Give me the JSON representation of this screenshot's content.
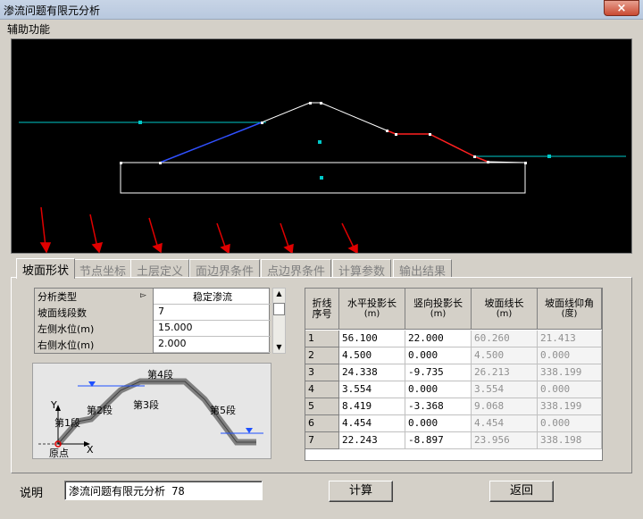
{
  "window": {
    "title": "渗流问题有限元分析",
    "close_label": "×"
  },
  "menu": {
    "items": [
      "辅助功能"
    ]
  },
  "tabs": [
    "坡面形状",
    "节点坐标",
    "土层定义",
    "面边界条件",
    "点边界条件",
    "计算参数",
    "输出结果"
  ],
  "params": [
    {
      "label": "分析类型",
      "value": "稳定渗流",
      "dropdown": true
    },
    {
      "label": "坡面线段数",
      "value": "7"
    },
    {
      "label": "左侧水位(m)",
      "value": "15.000"
    },
    {
      "label": "右侧水位(m)",
      "value": "2.000"
    }
  ],
  "diagram": {
    "labels": {
      "seg4": "第4段",
      "seg2": "第2段",
      "seg3": "第3段",
      "seg5": "第5段",
      "seg1": "第1段",
      "origin": "原点",
      "y_axis": "Y",
      "x_axis": "X"
    }
  },
  "grid": {
    "headers": [
      {
        "title": "折线\n序号",
        "unit": ""
      },
      {
        "title": "水平投影长",
        "unit": "(m)"
      },
      {
        "title": "竖向投影长",
        "unit": "(m)"
      },
      {
        "title": "坡面线长",
        "unit": "(m)"
      },
      {
        "title": "坡面线仰角",
        "unit": "(度)"
      }
    ],
    "rows": [
      [
        "1",
        "56.100",
        "22.000",
        "60.260",
        "21.413"
      ],
      [
        "2",
        "4.500",
        "0.000",
        "4.500",
        "0.000"
      ],
      [
        "3",
        "24.338",
        "-9.735",
        "26.213",
        "338.199"
      ],
      [
        "4",
        "3.554",
        "0.000",
        "3.554",
        "0.000"
      ],
      [
        "5",
        "8.419",
        "-3.368",
        "9.068",
        "338.199"
      ],
      [
        "6",
        "4.454",
        "0.000",
        "4.454",
        "0.000"
      ],
      [
        "7",
        "22.243",
        "-8.897",
        "23.956",
        "338.198"
      ]
    ]
  },
  "footer": {
    "desc_label": "说明",
    "desc_value": "渗流问题有限元分析 78",
    "calc_button": "计算",
    "back_button": "返回"
  },
  "colors": {
    "water": "#00c8c8",
    "segment_blue": "#3050ff",
    "segment_red": "#ff2020",
    "arrow": "#e00000",
    "canvas_bg": "#000000"
  }
}
